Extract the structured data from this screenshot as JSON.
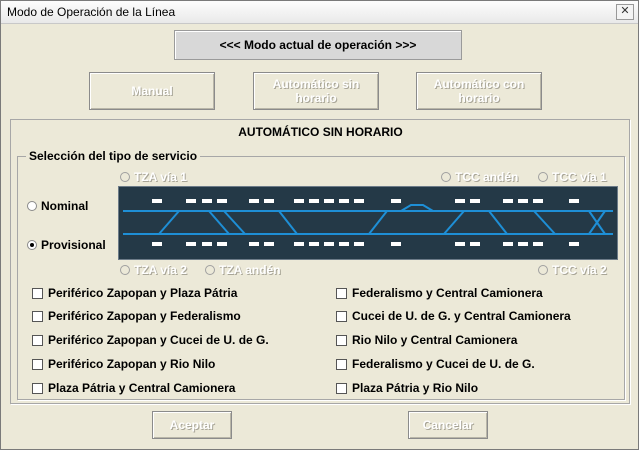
{
  "window": {
    "title": "Modo de Operación de la Línea",
    "close_glyph": "✕"
  },
  "status": {
    "text": "<<< Modo actual de operación >>>"
  },
  "mode_buttons": {
    "manual": "Manual",
    "auto_sin": "Automático sin horario",
    "auto_con": "Automático con horario"
  },
  "group": {
    "title": "AUTOMÁTICO SIN HORARIO",
    "service_label": "Selección del tipo de servicio"
  },
  "service_types": [
    {
      "label": "Nominal",
      "checked": false
    },
    {
      "label": "Provisional",
      "checked": true
    }
  ],
  "stations": {
    "tza_via1": "TZA vía 1",
    "tcc_anden": "TCC andén",
    "tcc_via1": "TCC vía 1",
    "tza_via2": "TZA vía 2",
    "tza_anden": "TZA andén",
    "tcc_via2": "TCC vía 2"
  },
  "routes_left": [
    "Periférico Zapopan y Plaza Pátria",
    "Periférico Zapopan y Federalismo",
    "Periférico Zapopan y Cucei de U. de G.",
    "Periférico Zapopan y Rio Nilo",
    "Plaza Pátria y Central Camionera"
  ],
  "routes_right": [
    "Federalismo y Central Camionera",
    "Cucei de U. de G. y Central Camionera",
    "Rio Nilo y Central Camionera",
    "Federalismo y Cucei de U. de G.",
    "Plaza Pátria y Rio Nilo"
  ],
  "actions": {
    "accept": "Aceptar",
    "cancel": "Cancelar"
  },
  "colors": {
    "track_bg": "#243947",
    "track_line": "#1e8fd6",
    "platform": "#ffffff"
  }
}
